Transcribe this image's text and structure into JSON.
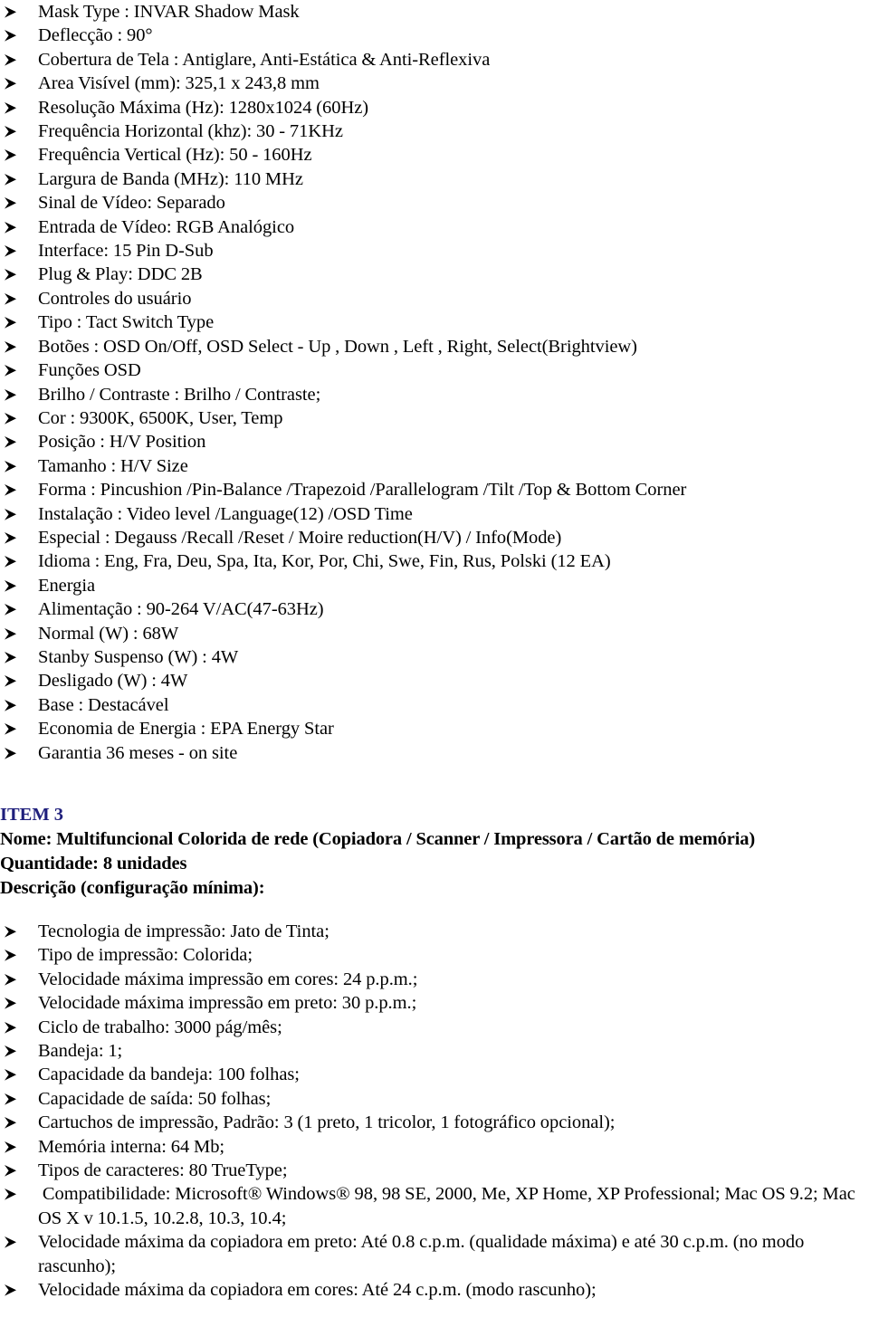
{
  "document": {
    "type": "technical-specification-document",
    "language": "pt-BR"
  },
  "colors": {
    "text": "#000000",
    "item_heading": "#1f1f7c",
    "background": "#ffffff"
  },
  "bullet": {
    "glyph_name": "arrowhead-bullet",
    "description": "right-pointing arrowhead (Wingdings 0xD8)"
  },
  "monitor_spec_list": [
    "Mask Type : INVAR Shadow Mask",
    "Deflecção : 90°",
    "Cobertura de Tela : Antiglare, Anti-Estática & Anti-Reflexiva",
    "Area Visível (mm): 325,1 x 243,8 mm",
    "Resolução Máxima (Hz): 1280x1024 (60Hz)",
    "Frequência Horizontal (khz): 30 - 71KHz",
    "Frequência Vertical (Hz): 50 - 160Hz",
    "Largura de Banda (MHz): 110 MHz",
    "Sinal de Vídeo: Separado",
    "Entrada de Vídeo: RGB Analógico",
    "Interface: 15 Pin D-Sub",
    "Plug & Play: DDC 2B",
    "Controles do usuário",
    "Tipo : Tact Switch Type",
    "Botões : OSD On/Off, OSD Select - Up , Down , Left , Right, Select(Brightview)",
    "Funções OSD",
    "Brilho / Contraste : Brilho / Contraste;",
    "Cor : 9300K, 6500K, User, Temp",
    "Posição : H/V Position",
    "Tamanho : H/V Size",
    "Forma : Pincushion /Pin-Balance /Trapezoid /Parallelogram /Tilt /Top & Bottom Corner",
    "Instalação : Video level /Language(12) /OSD Time",
    "Especial : Degauss /Recall /Reset / Moire reduction(H/V) / Info(Mode)",
    "Idioma : Eng, Fra, Deu, Spa, Ita, Kor, Por, Chi, Swe, Fin, Rus, Polski (12 EA)",
    "Energia",
    "Alimentação : 90-264 V/AC(47-63Hz)",
    "Normal (W) : 68W",
    "Stanby Suspenso (W) : 4W",
    "Desligado (W) : 4W",
    "Base : Destacável",
    "Economia de Energia : EPA Energy Star",
    "Garantia 36 meses - on site"
  ],
  "item3": {
    "label": "ITEM 3",
    "name_line": "Nome: Multifuncional Colorida de rede (Copiadora / Scanner / Impressora / Cartão de memória)",
    "quantity_line": "Quantidade: 8 unidades",
    "description_line": "Descrição (configuração mínima):",
    "spec_list": [
      "Tecnologia de impressão: Jato de Tinta;",
      "Tipo de impressão: Colorida;",
      "Velocidade máxima impressão em cores: 24 p.p.m.;",
      "Velocidade máxima impressão em preto: 30 p.p.m.;",
      "Ciclo de trabalho: 3000 pág/mês;",
      "Bandeja: 1;",
      "Capacidade da bandeja: 100 folhas;",
      "Capacidade de saída: 50 folhas;",
      "Cartuchos de impressão, Padrão: 3 (1 preto, 1 tricolor, 1 fotográfico opcional);",
      "Memória interna: 64 Mb;",
      "Tipos de caracteres: 80 TrueType;",
      " Compatibilidade: Microsoft® Windows® 98, 98 SE, 2000, Me, XP Home, XP Professional; Mac OS 9.2; Mac OS X v 10.1.5, 10.2.8, 10.3, 10.4;",
      "Velocidade máxima da copiadora em preto: Até 0.8 c.p.m. (qualidade máxima) e até 30 c.p.m. (no modo rascunho);",
      "Velocidade máxima da copiadora em cores: Até 24 c.p.m. (modo rascunho);"
    ]
  }
}
